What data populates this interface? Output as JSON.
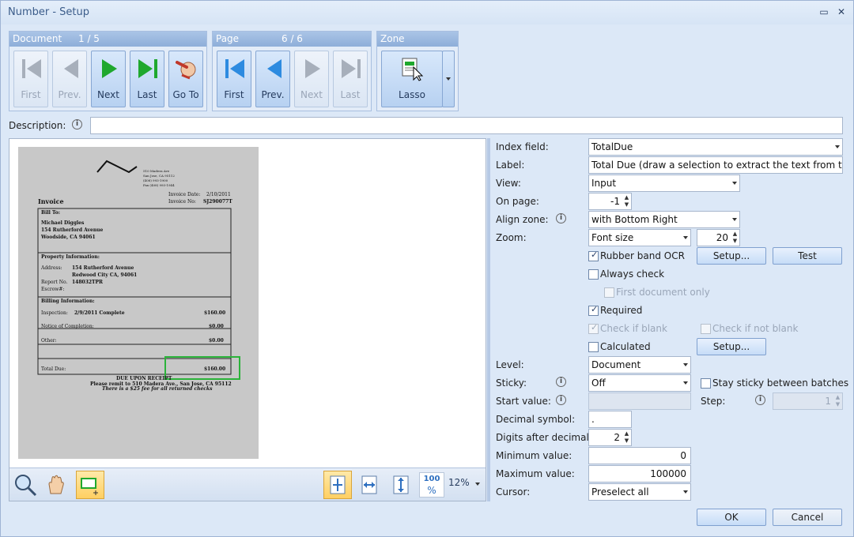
{
  "window": {
    "title": "Number - Setup",
    "restore_glyph": "▭",
    "close_glyph": "✕"
  },
  "groups": {
    "document": {
      "title": "Document",
      "count": "1 / 5",
      "buttons": {
        "first": "First",
        "prev": "Prev.",
        "next": "Next",
        "last": "Last",
        "goto": "Go To"
      }
    },
    "page": {
      "title": "Page",
      "count": "6 / 6",
      "buttons": {
        "first": "First",
        "prev": "Prev.",
        "next": "Next",
        "last": "Last"
      }
    },
    "zone": {
      "title": "Zone",
      "lasso": "Lasso"
    }
  },
  "description": {
    "label": "Description:",
    "value": ""
  },
  "preview": {
    "zoom": "12%",
    "fit_100_top": "100",
    "fit_100_bottom": "%",
    "doc": {
      "company_addr_1": "510 Madera Ave",
      "company_addr_2": "San Jose, CA 95112",
      "company_addr_3": "(408) 993-1900",
      "company_addr_4": "Fax (408) 993-1944",
      "invoice_title": "Invoice",
      "invoice_date_label": "Invoice Date:",
      "invoice_date": "2/10/2011",
      "invoice_no_label": "Invoice No:",
      "invoice_no": "SJ290077T",
      "bill_to": "Bill To:",
      "bill_name": "Michael Diggles",
      "bill_addr1": "154 Rutherford Avenue",
      "bill_addr2": "Woodside, CA 94061",
      "prop_info": "Property Information:",
      "address_label": "Address:",
      "prop_addr1": "154 Rutherford Avenue",
      "prop_addr2": "Redwood City CA, 94061",
      "report_no_label": "Report No.",
      "report_no": "148032TPR",
      "escrow_label": "Escrow#:",
      "billing_info": "Billing Information:",
      "inspection_label": "Inspection:",
      "inspection_detail": "2/9/2011   Complete",
      "inspection_amount": "$160.00",
      "notice_label": "Notice of Completion:",
      "notice_amount": "$0.00",
      "other_label": "Other:",
      "other_amount": "$0.00",
      "total_label": "Total Due:",
      "total_amount": "$160.00",
      "due_receipt": "DUE UPON RECEIPT",
      "remit": "Please remit to 510 Madera Ave., San Jose, CA 95112",
      "fee_note": "There is a $25 fee for all returned checks"
    }
  },
  "form": {
    "index_field": {
      "label": "Index field:",
      "value": "TotalDue"
    },
    "label": {
      "label": "Label:",
      "value": "Total Due (draw a selection to extract the text from the imag"
    },
    "view": {
      "label": "View:",
      "value": "Input"
    },
    "on_page": {
      "label": "On page:",
      "value": "-1"
    },
    "align_zone": {
      "label": "Align zone:",
      "value": "with Bottom Right"
    },
    "zoom": {
      "label": "Zoom:",
      "value": "Font size",
      "size": "20"
    },
    "rubber_band": {
      "label": "Rubber band OCR",
      "setup": "Setup...",
      "test": "Test"
    },
    "always_check": {
      "label": "Always check"
    },
    "first_doc_only": {
      "label": "First document only"
    },
    "required": {
      "label": "Required"
    },
    "check_if_blank": {
      "label": "Check if blank"
    },
    "check_if_not_blank": {
      "label": "Check if not blank"
    },
    "calculated": {
      "label": "Calculated",
      "setup": "Setup..."
    },
    "level": {
      "label": "Level:",
      "value": "Document"
    },
    "sticky": {
      "label": "Sticky:",
      "value": "Off",
      "between_batches": "Stay sticky between batches"
    },
    "start_value": {
      "label": "Start value:",
      "value": ""
    },
    "step": {
      "label": "Step:",
      "value": "1"
    },
    "decimal_symbol": {
      "label": "Decimal symbol:",
      "value": "."
    },
    "digits_after_decimal": {
      "label": "Digits after decimal:",
      "value": "2"
    },
    "minimum_value": {
      "label": "Minimum value:",
      "value": "0"
    },
    "maximum_value": {
      "label": "Maximum value:",
      "value": "100000"
    },
    "cursor": {
      "label": "Cursor:",
      "value": "Preselect all"
    }
  },
  "footer": {
    "ok": "OK",
    "cancel": "Cancel"
  },
  "icons": {
    "info": "i",
    "check": "✓",
    "spin_up": "▲",
    "spin_down": "▼"
  },
  "colors": {
    "accent": "#1a9f2a",
    "nav_blue": "#2d8be0",
    "selection": "#2bb33a"
  }
}
